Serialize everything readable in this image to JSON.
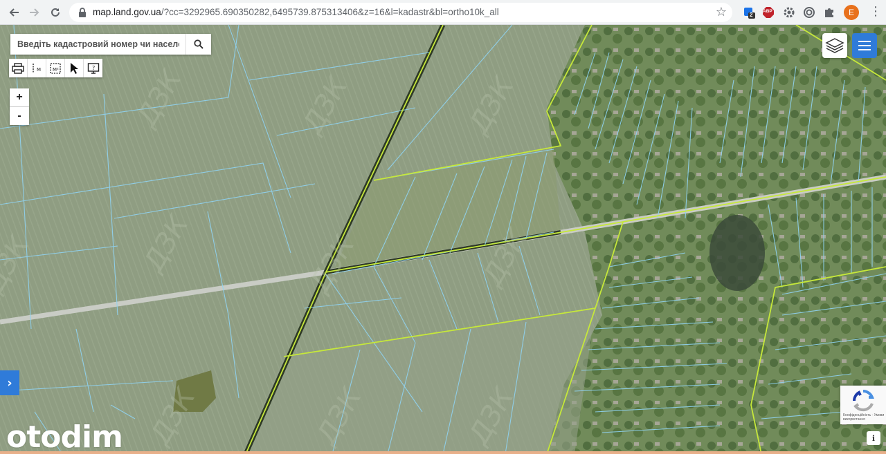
{
  "browser": {
    "url_host": "map.land.gov.ua",
    "url_rest": "/?cc=3292965.690350282,6495739.875313406&z=16&l=kadastr&bl=ortho10k_all",
    "extensions": {
      "badge_count": "2",
      "abp_label": "ABP",
      "avatar_letter": "E"
    },
    "icons": [
      "back-icon",
      "forward-icon",
      "reload-icon",
      "lock-icon",
      "star-icon",
      "gear-icon",
      "puzzle-icon",
      "more-icon"
    ]
  },
  "map": {
    "search": {
      "placeholder": "Введіть кадастровий номер чи населений"
    },
    "tools": [
      "print-icon",
      "measure-line-icon",
      "measure-area-icon",
      "pointer-icon",
      "info-screen-icon"
    ],
    "zoom": {
      "in_label": "+",
      "out_label": "-"
    },
    "side_toggle": "›",
    "recaptcha_text": "Конфіденційність - Умови використання",
    "info_label": "i",
    "watermark_text": "otodim",
    "colors": {
      "parcel_line": "#8fd3f2",
      "boundary_line": "#c6e83a",
      "accent_blue": "#2f7bd9",
      "field": "#8c9a7e"
    }
  }
}
